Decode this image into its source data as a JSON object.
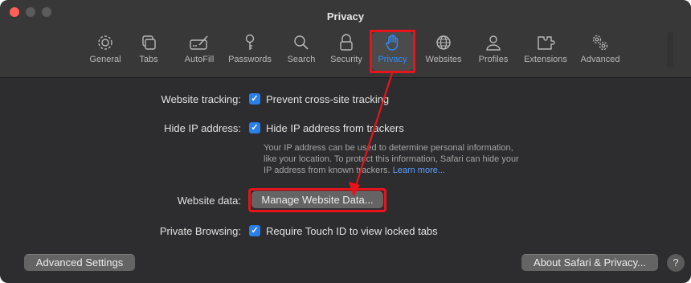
{
  "window": {
    "title": "Privacy"
  },
  "toolbar": {
    "tabs": [
      {
        "label": "General",
        "icon": "gear-icon"
      },
      {
        "label": "Tabs",
        "icon": "tabs-icon"
      },
      {
        "label": "AutoFill",
        "icon": "autofill-icon"
      },
      {
        "label": "Passwords",
        "icon": "key-icon"
      },
      {
        "label": "Search",
        "icon": "search-icon"
      },
      {
        "label": "Security",
        "icon": "lock-icon"
      },
      {
        "label": "Privacy",
        "icon": "hand-icon",
        "active": true
      },
      {
        "label": "Websites",
        "icon": "globe-icon"
      },
      {
        "label": "Profiles",
        "icon": "person-icon"
      },
      {
        "label": "Extensions",
        "icon": "puzzle-icon"
      },
      {
        "label": "Advanced",
        "icon": "gears-icon"
      }
    ]
  },
  "settings": {
    "tracking": {
      "label": "Website tracking:",
      "option": "Prevent cross-site tracking",
      "checked": true
    },
    "hide_ip": {
      "label": "Hide IP address:",
      "option": "Hide IP address from trackers",
      "checked": true,
      "description_lines": [
        "Your IP address can be used to determine personal information,",
        "like your location. To protect this information, Safari can hide your",
        "IP address from known trackers."
      ],
      "link": "Learn more..."
    },
    "website_data": {
      "label": "Website data:",
      "button": "Manage Website Data..."
    },
    "private_browsing": {
      "label": "Private Browsing:",
      "option": "Require Touch ID to view locked tabs",
      "checked": true
    }
  },
  "footer": {
    "advanced_button": "Advanced Settings",
    "about_button": "About Safari & Privacy...",
    "help": "?"
  },
  "colors": {
    "accent": "#2e8dff",
    "annotation": "#e8141c",
    "checkbox": "#2a7fe8"
  }
}
